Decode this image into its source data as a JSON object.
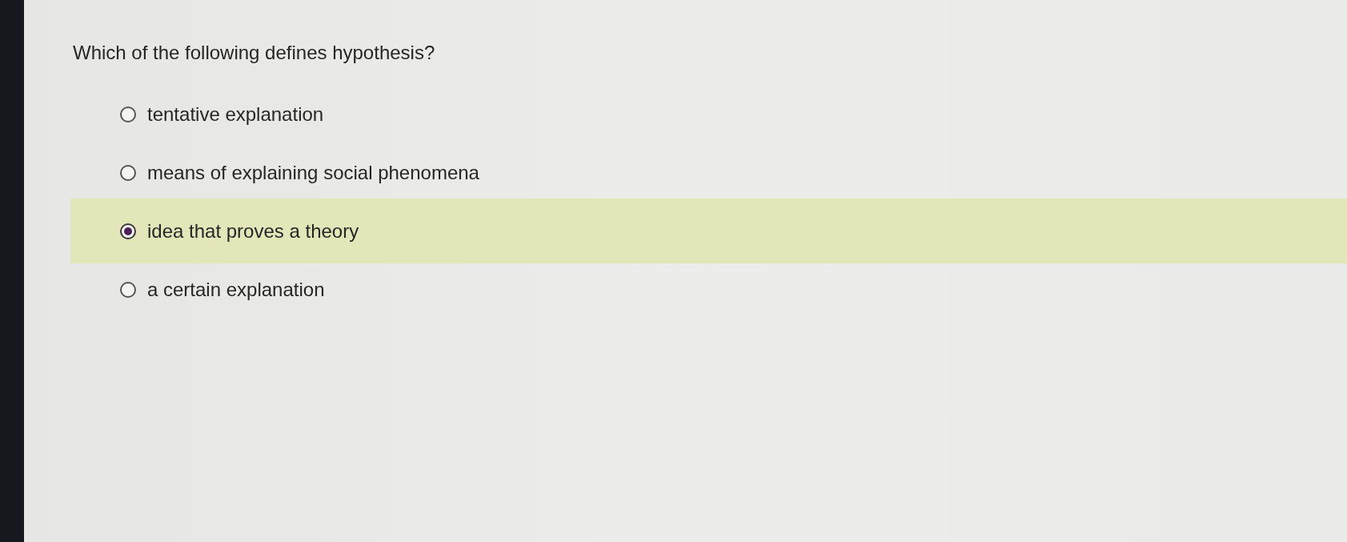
{
  "question": "Which of the following defines hypothesis?",
  "options": [
    {
      "label": "tentative explanation",
      "selected": false
    },
    {
      "label": "means of explaining social phenomena",
      "selected": false
    },
    {
      "label": "idea that proves a theory",
      "selected": true
    },
    {
      "label": "a certain explanation",
      "selected": false
    }
  ]
}
